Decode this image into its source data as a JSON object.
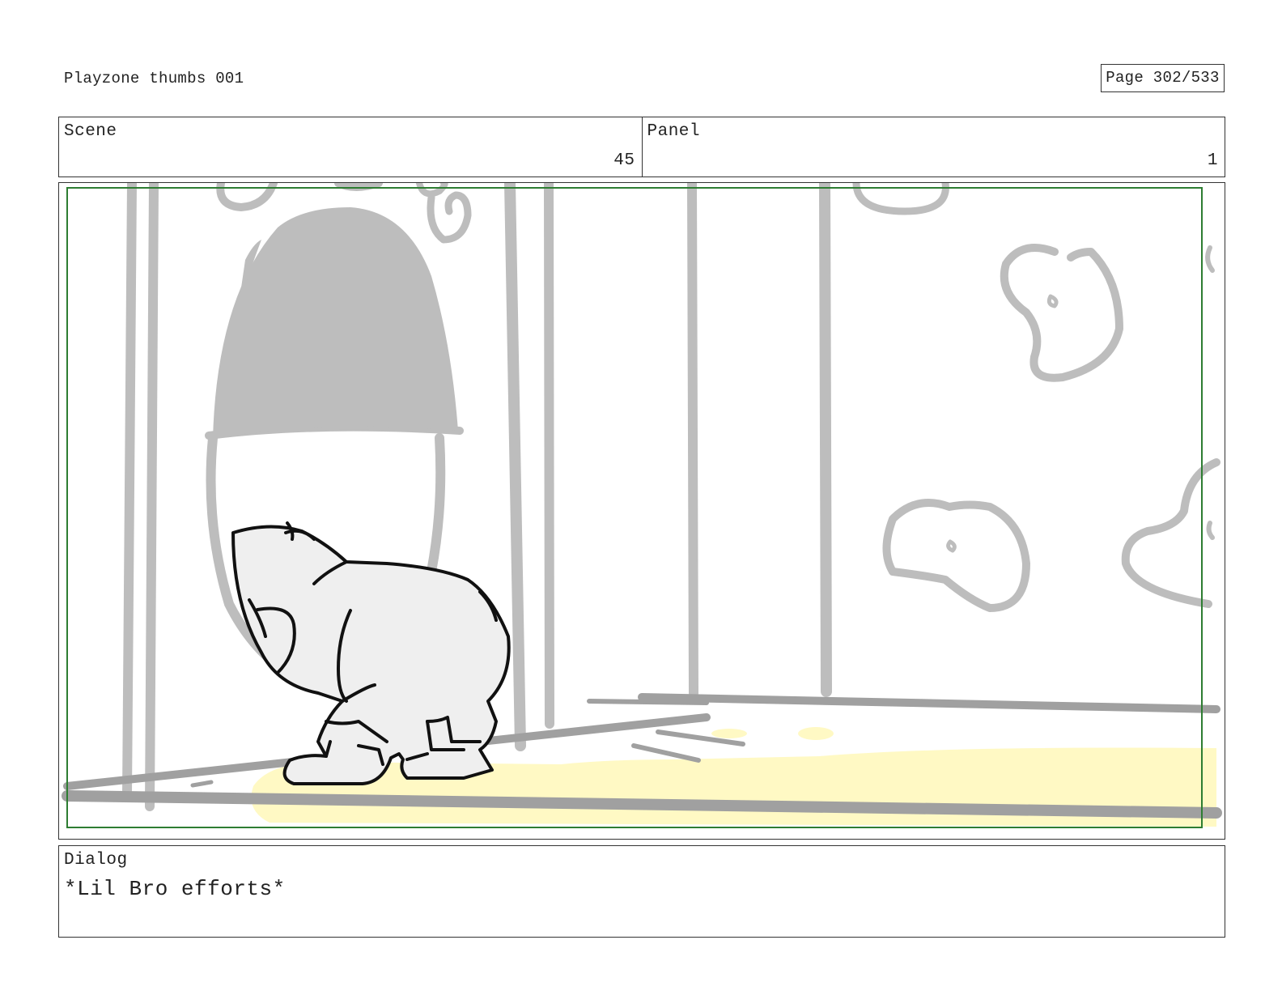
{
  "document": {
    "title": "Playzone thumbs 001",
    "page_indicator": "Page 302/533"
  },
  "header": {
    "scene_label": "Scene",
    "scene_value": "45",
    "panel_label": "Panel",
    "panel_value": "1"
  },
  "panel_image": {
    "description_icon": "storyboard-sketch-image",
    "safe_frame_color": "#2e7d32",
    "background_sketch_color": "#bdbdbd",
    "puddle_color": "#fff9c4",
    "character_fill": "#efefef",
    "character_line": "#111111"
  },
  "dialog": {
    "label": "Dialog",
    "text": "*Lil Bro efforts*"
  }
}
